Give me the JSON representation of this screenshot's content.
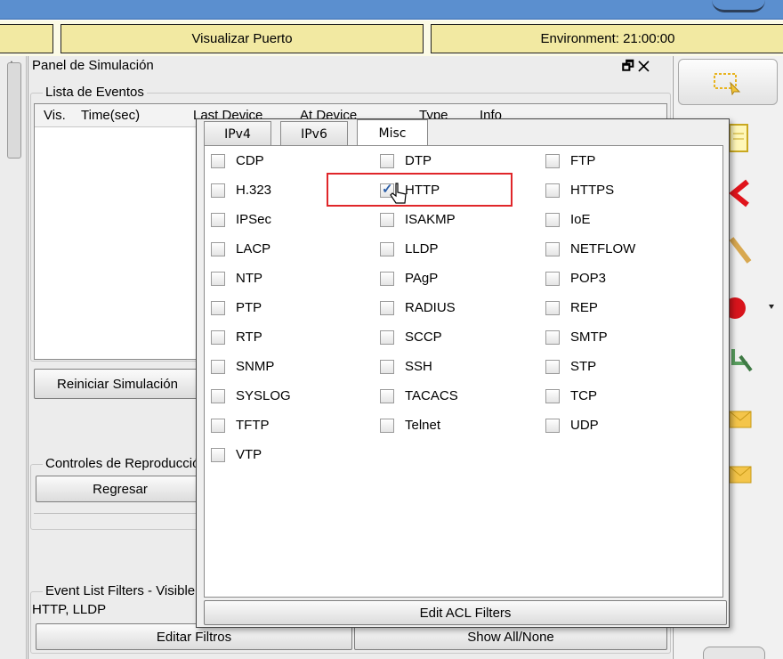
{
  "toolbar_top": {
    "visualizar_puerto": "Visualizar Puerto",
    "environment": "Environment: 21:00:00"
  },
  "sim_panel": {
    "title": "Panel de Simulación",
    "window_controls": "🗗 ✕",
    "event_list_label": "Lista de Eventos",
    "columns": [
      "Vis.",
      "Time(sec)",
      "Last Device",
      "At Device",
      "Type",
      "Info"
    ],
    "reset_button": "Reiniciar Simulación",
    "playback_label": "Controles de Reproducción",
    "back_button": "Regresar",
    "filters_label": "Event List Filters - Visible Events",
    "visible_events": "HTTP, LLDP",
    "edit_filters_button": "Editar Filtros",
    "show_all_button": "Show All/None"
  },
  "filter_popup": {
    "tabs": [
      {
        "label": "IPv4",
        "active": false
      },
      {
        "label": "IPv6",
        "active": false
      },
      {
        "label": "Misc",
        "active": true
      }
    ],
    "protocols": [
      {
        "label": "CDP",
        "checked": false
      },
      {
        "label": "DTP",
        "checked": false
      },
      {
        "label": "FTP",
        "checked": false
      },
      {
        "label": "H.323",
        "checked": false
      },
      {
        "label": "HTTP",
        "checked": true
      },
      {
        "label": "HTTPS",
        "checked": false
      },
      {
        "label": "IPSec",
        "checked": false
      },
      {
        "label": "ISAKMP",
        "checked": false
      },
      {
        "label": "IoE",
        "checked": false
      },
      {
        "label": "LACP",
        "checked": false
      },
      {
        "label": "LLDP",
        "checked": false
      },
      {
        "label": "NETFLOW",
        "checked": false
      },
      {
        "label": "NTP",
        "checked": false
      },
      {
        "label": "PAgP",
        "checked": false
      },
      {
        "label": "POP3",
        "checked": false
      },
      {
        "label": "PTP",
        "checked": false
      },
      {
        "label": "RADIUS",
        "checked": false
      },
      {
        "label": "REP",
        "checked": false
      },
      {
        "label": "RTP",
        "checked": false
      },
      {
        "label": "SCCP",
        "checked": false
      },
      {
        "label": "SMTP",
        "checked": false
      },
      {
        "label": "SNMP",
        "checked": false
      },
      {
        "label": "SSH",
        "checked": false
      },
      {
        "label": "STP",
        "checked": false
      },
      {
        "label": "SYSLOG",
        "checked": false
      },
      {
        "label": "TACACS",
        "checked": false
      },
      {
        "label": "TCP",
        "checked": false
      },
      {
        "label": "TFTP",
        "checked": false
      },
      {
        "label": "Telnet",
        "checked": false
      },
      {
        "label": "UDP",
        "checked": false
      },
      {
        "label": "VTP",
        "checked": false
      }
    ],
    "edit_acl_button": "Edit ACL Filters",
    "highlight_color": "#e0262a"
  },
  "right_tools": [
    "select-tool-icon",
    "note-icon",
    "delete-icon",
    "inspect-icon",
    "draw-shape-icon",
    "resize-icon",
    "simple-pdu-icon",
    "complex-pdu-icon"
  ]
}
